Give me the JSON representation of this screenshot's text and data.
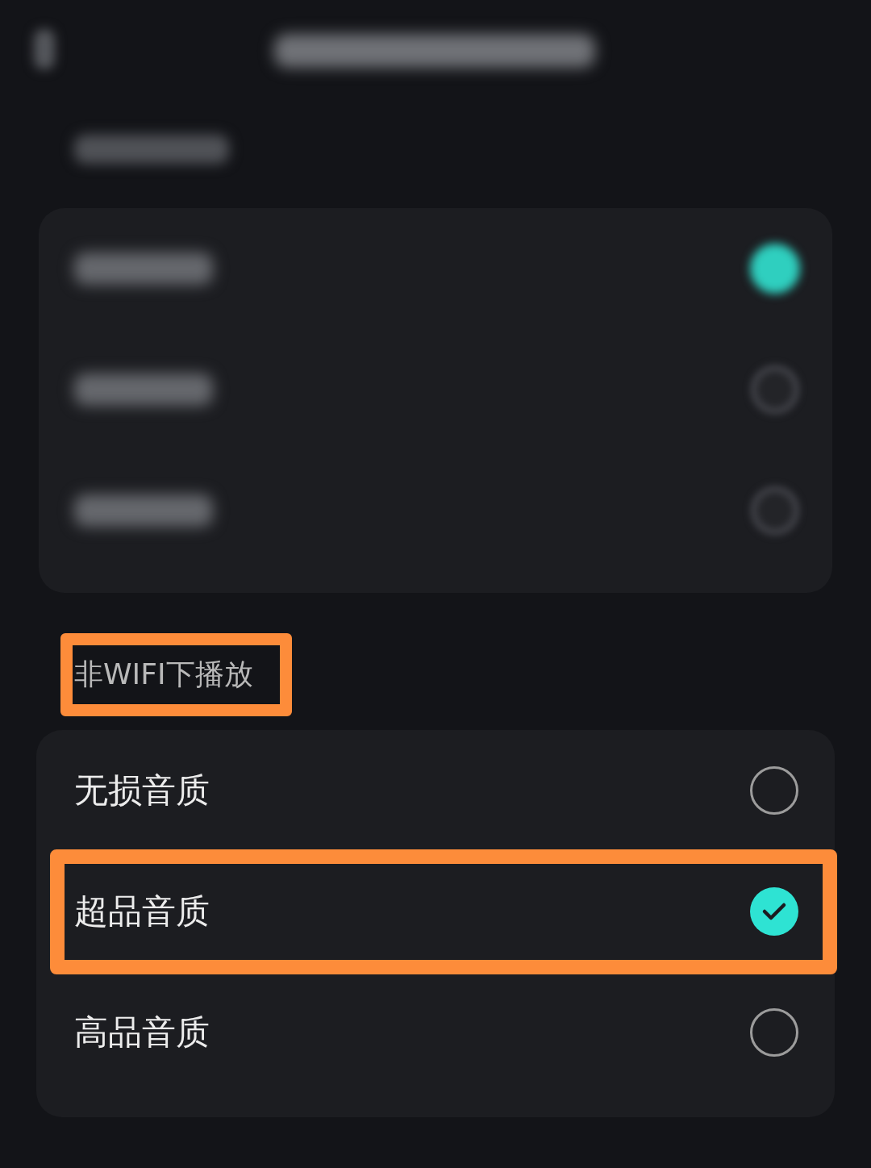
{
  "blurred_options": [
    {
      "selected": true
    },
    {
      "selected": false
    },
    {
      "selected": false
    }
  ],
  "section": {
    "title": "非WIFI下播放",
    "highlighted": true
  },
  "options": [
    {
      "label": "无损音质",
      "selected": false,
      "highlighted": false
    },
    {
      "label": "超品音质",
      "selected": true,
      "highlighted": true
    },
    {
      "label": "高品音质",
      "selected": false,
      "highlighted": false
    }
  ]
}
